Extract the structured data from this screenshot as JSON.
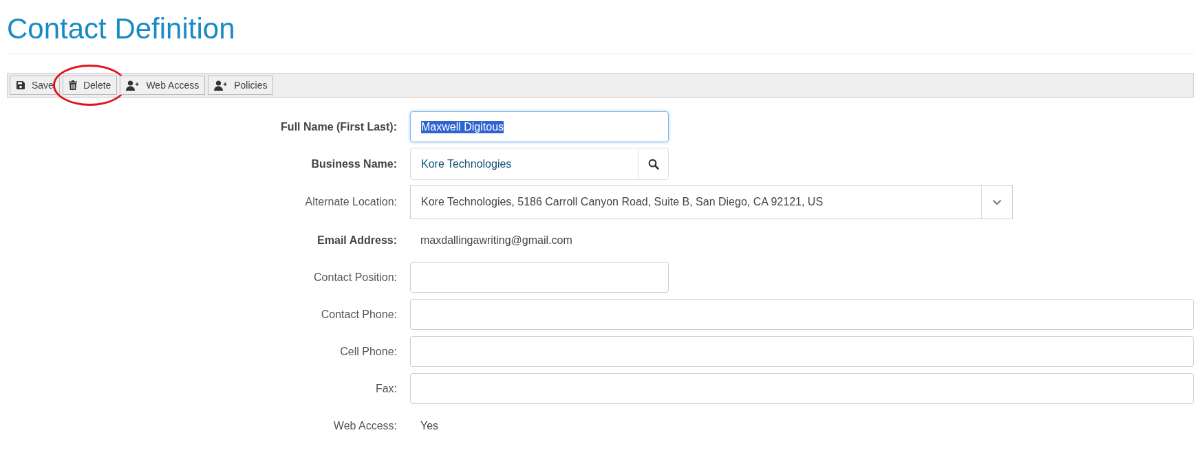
{
  "title": "Contact Definition",
  "toolbar": {
    "buttons": [
      {
        "label": "Save",
        "kind": "save",
        "circled": false
      },
      {
        "label": "Delete",
        "kind": "delete",
        "circled": true
      },
      {
        "label": "Web Access",
        "kind": "user-add",
        "circled": false
      },
      {
        "label": "Policies",
        "kind": "user-add",
        "circled": false
      }
    ]
  },
  "form": {
    "rows": [
      {
        "label": "Full Name (First Last):",
        "bold": true,
        "kind": "short-input",
        "value": "Maxwell Digitous",
        "focused": true,
        "text_selected": true
      },
      {
        "label": "Business Name:",
        "bold": true,
        "kind": "lookup",
        "value": "Kore Technologies"
      },
      {
        "label": "Alternate Location:",
        "bold": false,
        "kind": "select",
        "value": "Kore Technologies, 5186 Carroll Canyon Road, Suite B, San Diego, CA  92121, US"
      },
      {
        "label": "Email Address:",
        "bold": true,
        "kind": "text",
        "value": "maxdallingawriting@gmail.com"
      },
      {
        "label": "Contact Position:",
        "bold": false,
        "kind": "short-input",
        "focused": false
      },
      {
        "label": "Contact Phone:",
        "bold": false,
        "kind": "wide-input",
        "focused": false
      },
      {
        "label": "Cell Phone:",
        "bold": false,
        "kind": "wide-input",
        "focused": false
      },
      {
        "label": "Fax:",
        "bold": false,
        "kind": "wide-input",
        "focused": false
      },
      {
        "label": "Web Access:",
        "bold": false,
        "kind": "text",
        "value": "Yes"
      }
    ]
  }
}
